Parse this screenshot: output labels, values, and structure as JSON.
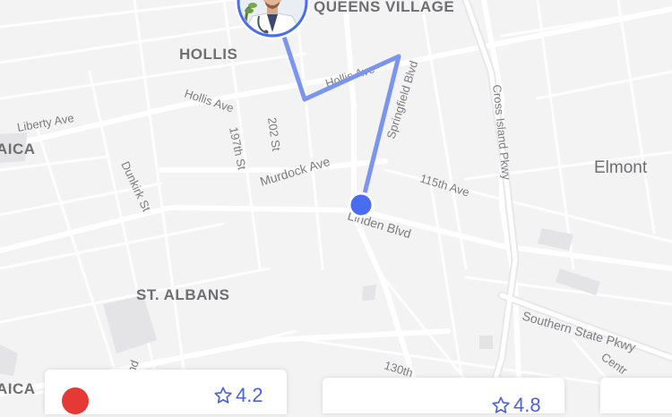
{
  "map": {
    "area_labels": [
      "QUEENS VILLAGE",
      "HOLLIS",
      "ST. ALBANS",
      "Elmont",
      "AICA",
      "AICA"
    ],
    "street_labels": [
      "Hollis Ave",
      "Hollis Ave",
      "Liberty Ave",
      "197th St",
      "202 St",
      "Murdock Ave",
      "Springfield Blvd",
      "Cross Island Pkwy",
      "115th Ave",
      "Dunkirk St",
      "Linden Blvd",
      "Southern State Pkwy",
      "130th",
      "Centr",
      "nd"
    ],
    "route_color": "#7b95ef",
    "location_dot_color": "#4a6cf0"
  },
  "cards": [
    {
      "rating": "4.2",
      "pin_color": "#e53935"
    },
    {
      "rating": "4.8"
    }
  ],
  "icons": [
    "doctor-avatar",
    "star-icon",
    "location-pin-icon"
  ]
}
